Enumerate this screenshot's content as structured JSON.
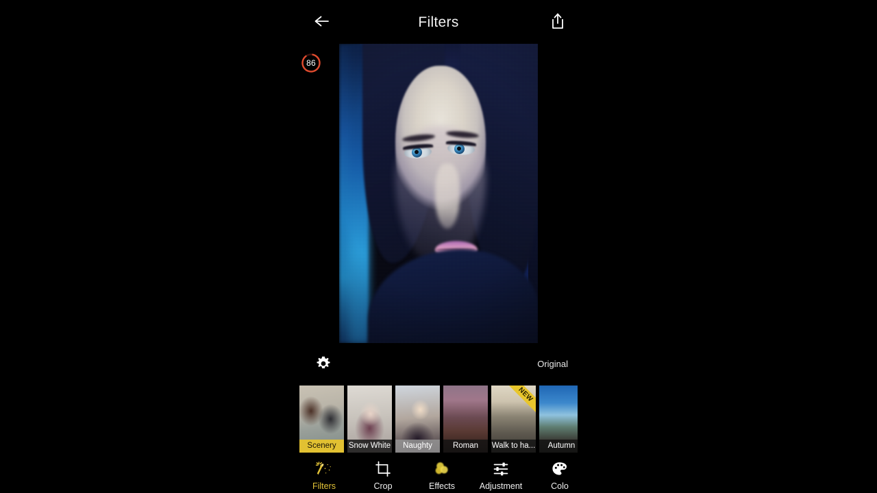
{
  "app": {
    "screen_title": "Filters",
    "theme_bg": "#000000",
    "accent": "#e2c132"
  },
  "topbar": {
    "back_icon": "arrow-left-icon",
    "title": "Filters",
    "share_icon": "share-icon"
  },
  "counter": {
    "value": "86",
    "ring_color": "#e04b2e",
    "percent": 86
  },
  "preview": {
    "alt": "portrait-photo-preview"
  },
  "controls": {
    "settings_icon": "gear-icon",
    "original_label": "Original"
  },
  "filters": [
    {
      "name": "Scenery",
      "art": "a-scenery",
      "state": "selected",
      "new": false
    },
    {
      "name": "Snow White",
      "art": "a-snow",
      "state": "normal",
      "new": false
    },
    {
      "name": "Naughty",
      "art": "a-naughty",
      "state": "highlight",
      "new": false
    },
    {
      "name": "Roman",
      "art": "a-roman",
      "state": "normal",
      "new": false
    },
    {
      "name": "Walk to ha...",
      "art": "a-walk",
      "state": "normal",
      "new": true,
      "badge": "NEW"
    },
    {
      "name": "Autumn",
      "art": "a-autumn",
      "state": "normal",
      "new": false
    }
  ],
  "bottom_nav": [
    {
      "label": "Filters",
      "icon": "magic-wand-icon",
      "active": true
    },
    {
      "label": "Crop",
      "icon": "crop-icon",
      "active": false
    },
    {
      "label": "Effects",
      "icon": "bokeh-icon",
      "active": false
    },
    {
      "label": "Adjustment",
      "icon": "sliders-icon",
      "active": false
    },
    {
      "label": "Colo",
      "icon": "palette-icon",
      "active": false
    }
  ]
}
